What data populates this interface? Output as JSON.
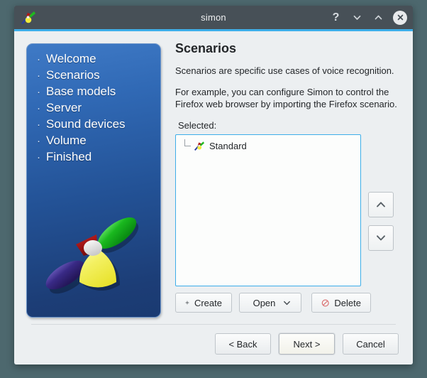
{
  "window": {
    "title": "simon",
    "titlebar_buttons": [
      {
        "name": "help-button",
        "glyph": "?"
      },
      {
        "name": "minimize-button",
        "glyph": "chevron-down-icon"
      },
      {
        "name": "maximize-button",
        "glyph": "chevron-up-icon"
      },
      {
        "name": "close-button",
        "glyph": "close-icon"
      }
    ]
  },
  "sidebar": {
    "bullet": "·",
    "items": [
      {
        "label": "Welcome"
      },
      {
        "label": "Scenarios"
      },
      {
        "label": "Base models"
      },
      {
        "label": "Server"
      },
      {
        "label": "Sound devices"
      },
      {
        "label": "Volume"
      },
      {
        "label": "Finished"
      }
    ]
  },
  "content": {
    "title": "Scenarios",
    "paragraph1": "Scenarios are specific use cases of voice recognition.",
    "paragraph2": "For example, you can configure Simon to control the Firefox web browser by importing the Firefox scenario.",
    "selected_label": "Selected:",
    "list_items": [
      {
        "label": "Standard",
        "icon": "simon-icon"
      }
    ],
    "move_up_icon": "chevron-up-icon",
    "move_down_icon": "chevron-down-icon",
    "buttons": {
      "create": "Create",
      "create_icon": "plus-icon",
      "open": "Open",
      "open_icon": "document-icon",
      "open_menu_icon": "chevron-down-icon",
      "delete": "Delete",
      "delete_icon": "prohibition-icon"
    }
  },
  "footer": {
    "back": "< Back",
    "next": "Next >",
    "cancel": "Cancel"
  },
  "colors": {
    "accent": "#3daee9",
    "titlebar": "#475057",
    "dialog_bg": "#eceff1",
    "desktop_bg": "#4d686e",
    "sidebar_top": "#3f7ac6",
    "sidebar_bottom": "#1a3a71",
    "delete_red": "#d96a6a"
  }
}
